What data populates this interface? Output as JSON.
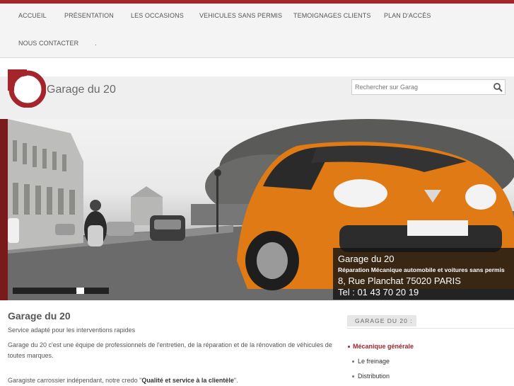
{
  "nav": {
    "items": [
      "ACCUEIL",
      "PRÉSENTATION",
      "LES OCCASIONS",
      "VEHICULES SANS PERMIS",
      "TEMOIGNAGES CLIENTS",
      "PLAN D'ACCÈS",
      "NOUS CONTACTER",
      "."
    ]
  },
  "header": {
    "logo_text": "Garage du 20",
    "search_placeholder": "Rechercher sur Garag"
  },
  "hero": {
    "caption_title": "Garage du 20",
    "caption_sub": "Réparation Mécanique automobile et voitures sans permis",
    "caption_address": "8, Rue Planchat 75020 PARIS",
    "caption_tel": "Tel : 01 43 70 20 19",
    "slide_number": "1"
  },
  "main": {
    "title": "Garage du 20",
    "subtitle": "Service adapté pour les interventions rapides",
    "paragraph": "Garage du 20 c'est une équipe de professionnels de l'entretien, de la réparation et de la rénovation de véhicules de toutes marques.",
    "paragraph2_prefix": "Garagiste carrossier indépendant, notre credo \"",
    "paragraph2_bold": "Qualité et service à la clientèle",
    "paragraph2_suffix": "\"."
  },
  "sidebar": {
    "heading": "GARAGE DU 20 :",
    "items": [
      "Mécanique générale",
      "Le freinage",
      "Distribution"
    ]
  },
  "colors": {
    "accent": "#a4262c",
    "car_orange": "#e07a14"
  }
}
